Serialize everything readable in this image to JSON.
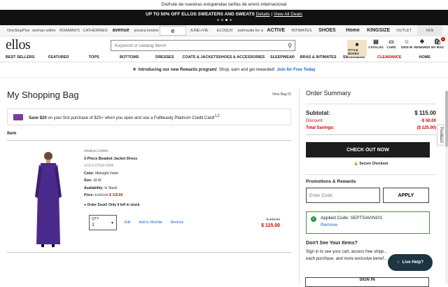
{
  "topmsg": "Disfrute de nuestras estupendas tarifas de envío internacional",
  "promo": {
    "text": "UP TO 50% OFF ELLOS SWEATERS AND SWEATS",
    "details": "Details",
    "view_all": "View All Deals"
  },
  "brands": [
    "OneStopPlus",
    "woman within",
    "ROAMAN'S",
    "CATHERINES",
    "avenue",
    "jessica london",
    "e",
    "JUNE+VIE",
    "ELOQUII",
    "swimsuits for all",
    "ACTIVE",
    "INTIMATES",
    "SHOES",
    "Home",
    "KINGSIZE",
    "OUTLET",
    "VEN"
  ],
  "header": {
    "logo": "ellos",
    "search_placeholder": "Keyword or catalog item#",
    "icons": [
      {
        "label": "STYLE BOXES"
      },
      {
        "label": "CATALOG"
      },
      {
        "label": "CARD"
      },
      {
        "label": "SIGN IN"
      },
      {
        "label": "REWARDS"
      },
      {
        "label": "MY BAG",
        "badge": "1"
      }
    ]
  },
  "nav": [
    "BEST SELLERS",
    "FEATURED",
    "TOPS",
    "BOTTOMS",
    "DRESSES",
    "COATS & JACKETS",
    "SHOES & ACCESSORIES",
    "SLEEPWEAR",
    "BRAS & INTIMATES",
    "SWIMWEAR",
    "CLEARANCE",
    "HOME"
  ],
  "rewards": {
    "bold": "Introducing our new Rewards program!",
    "text": "Shop, earn and get rewarded!",
    "link": "Join for Free Today"
  },
  "bag": {
    "title": "My Shopping Bag",
    "view_bag_id": "View Bag ID",
    "cc_offer": {
      "bold": "Save $20",
      "text": "on your first purchase of $25+ when you open and use a Fullbeauty Platinum Credit Card!",
      "sup": "1,2"
    },
    "item_header": "Item",
    "item": {
      "brand": "Jessica London",
      "name": "2-Piece Beaded Jacket Dress",
      "sku": "#2313-07530-9999",
      "color_label": "Color:",
      "color": "Midnight Violet",
      "size_label": "Size:",
      "size": "18 W",
      "avail_label": "Availability:",
      "avail": "In Stock",
      "price_label": "Price:",
      "orig_price": "$ 190.00",
      "sale_price": "$ 115.00",
      "stock_note": "Order Soon! Only 9 left in stock",
      "qty_label": "QTY",
      "qty": "1",
      "edit": "Edit",
      "wishlist": "Add to Wishlist",
      "remove": "Remove",
      "line_orig": "$ 190.00",
      "line_sale": "$ 115.00"
    }
  },
  "summary": {
    "title": "Order Summary",
    "subtotal_label": "Subtotal:",
    "subtotal": "$ 115.00",
    "discount_label": "Discount:",
    "discount": "-$ 50.00",
    "savings_label": "Total Savings:",
    "savings": "($ 125.00)",
    "checkout": "CHECK OUT NOW",
    "secure": "Secure Checkout",
    "promo_header": "Promotions & Rewards",
    "code_placeholder": "Enter Code",
    "apply": "APPLY",
    "applied": "Applied Code: SEPTSAVINGS",
    "applied_remove": "Remove",
    "dont_see": "Don't See Your Items?",
    "dont_see_text": "Sign in to see your cart, access free shipp... each purchase, and more exclusive benef...",
    "signin": "SIGN IN"
  },
  "feedback": "Feedback",
  "live_help": "Live Help?"
}
